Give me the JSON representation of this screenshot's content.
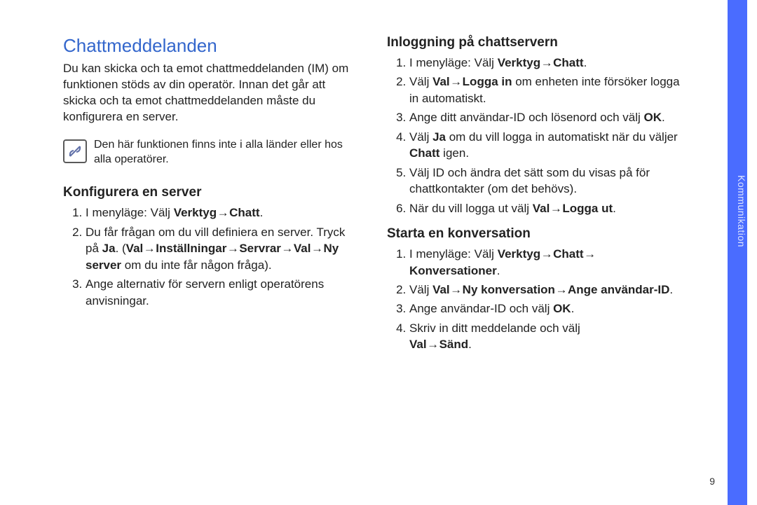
{
  "title": "Chattmeddelanden",
  "intro": "Du kan skicka och ta emot chattmeddelanden (IM) om funktionen stöds av din operatör. Innan det går att skicka och ta emot chattmeddelanden måste du konfigurera en server.",
  "note": "Den här funktionen finns inte i alla länder eller hos alla operatörer.",
  "sec1": {
    "heading": "Konfigurera en server",
    "s1_pre": "I menyläge: Välj ",
    "s1_b1": "Verktyg",
    "s1_b2": "Chatt",
    "s2_pre": "Du får frågan om du vill definiera en server. Tryck på ",
    "s2_b1": "Ja",
    "s2_mid1": ". (",
    "s2_b2": "Val",
    "s2_b3": "Inställningar",
    "s2_b4": "Servrar",
    "s2_b5": "Val",
    "s2_b6": "Ny server",
    "s2_post": " om du inte får någon fråga).",
    "s3": "Ange alternativ för servern enligt operatörens anvisningar."
  },
  "sec2": {
    "heading": "Inloggning på chattservern",
    "s1_pre": "I menyläge: Välj ",
    "s1_b1": "Verktyg",
    "s1_b2": "Chatt",
    "s2_pre": "Välj ",
    "s2_b1": "Val",
    "s2_b2": "Logga in",
    "s2_post": " om enheten inte försöker logga in automatiskt.",
    "s3_pre": "Ange ditt användar-ID och lösenord och välj ",
    "s3_b1": "OK",
    "s4_pre": "Välj ",
    "s4_b1": "Ja",
    "s4_mid": " om du vill logga in automatiskt när du väljer ",
    "s4_b2": "Chatt",
    "s4_post": " igen.",
    "s5": "Välj ID och ändra det sätt som du visas på för chattkontakter (om det behövs).",
    "s6_pre": "När du vill logga ut välj ",
    "s6_b1": "Val",
    "s6_b2": "Logga ut"
  },
  "sec3": {
    "heading": "Starta en konversation",
    "s1_pre": "I menyläge: Välj ",
    "s1_b1": "Verktyg",
    "s1_b2": "Chatt",
    "s1_b3": "Konversationer",
    "s2_pre": "Välj ",
    "s2_b1": "Val",
    "s2_b2": "Ny konversation",
    "s2_b3": "Ange användar-ID",
    "s3_pre": "Ange användar-ID och välj ",
    "s3_b1": "OK",
    "s4_pre": "Skriv in ditt meddelande och välj ",
    "s4_b1": "Val",
    "s4_b2": "Sänd"
  },
  "sideLabel": "Kommunikation",
  "pageNumber": "9",
  "arrow": "→"
}
